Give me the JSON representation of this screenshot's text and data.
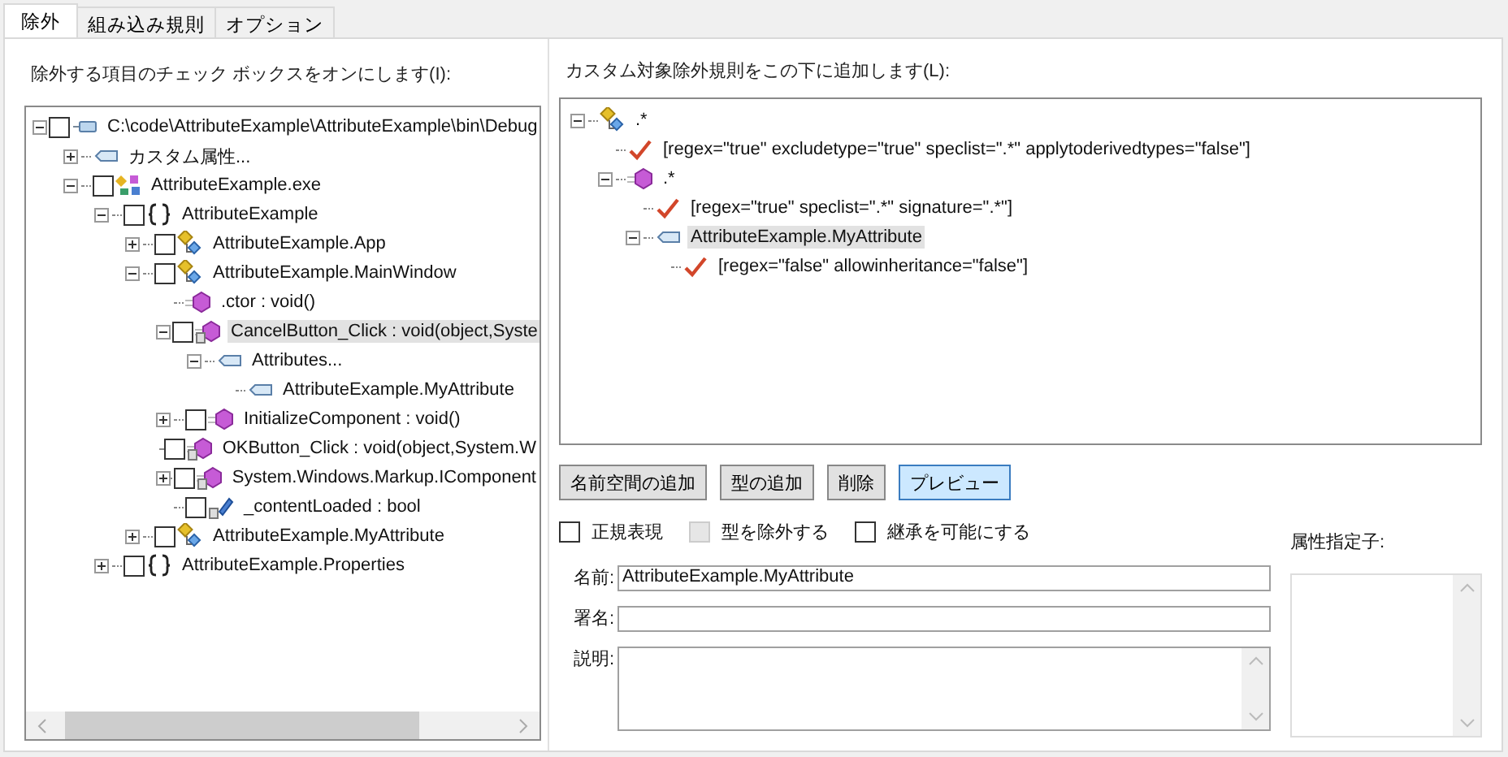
{
  "tabs": [
    {
      "label": "除外",
      "selected": true
    },
    {
      "label": "組み込み規則",
      "selected": false
    },
    {
      "label": "オプション",
      "selected": false
    }
  ],
  "exclude_panel": {
    "label": "除外する項目のチェック ボックスをオンにします(I):",
    "tree": [
      {
        "kind": "assembly",
        "label": "C:\\code\\AttributeExample\\AttributeExample\\bin\\Debug",
        "checked": false,
        "expanded": true,
        "selected": false,
        "children": [
          {
            "kind": "attribute",
            "label": "カスタム属性...",
            "expanded": false,
            "selected": false
          },
          {
            "kind": "exe",
            "label": "AttributeExample.exe",
            "checked": false,
            "expanded": true,
            "selected": false,
            "children": [
              {
                "kind": "namespace",
                "label": "AttributeExample",
                "checked": false,
                "expanded": true,
                "selected": false,
                "children": [
                  {
                    "kind": "class",
                    "label": "AttributeExample.App",
                    "checked": false,
                    "expanded": false,
                    "selected": false
                  },
                  {
                    "kind": "class",
                    "label": "AttributeExample.MainWindow",
                    "checked": false,
                    "expanded": true,
                    "selected": false,
                    "children": [
                      {
                        "kind": "method",
                        "label": ".ctor : void()",
                        "selected": false
                      },
                      {
                        "kind": "private_method",
                        "label": "CancelButton_Click : void(object,Syste",
                        "checked": false,
                        "expanded": true,
                        "selected": true,
                        "children": [
                          {
                            "kind": "attribute",
                            "label": "Attributes...",
                            "expanded": true,
                            "selected": false,
                            "children": [
                              {
                                "kind": "attribute",
                                "label": "AttributeExample.MyAttribute",
                                "selected": false
                              }
                            ]
                          }
                        ]
                      },
                      {
                        "kind": "method",
                        "label": "InitializeComponent : void()",
                        "checked": false,
                        "expanded": false,
                        "selected": false
                      },
                      {
                        "kind": "private_method",
                        "label": "OKButton_Click : void(object,System.W",
                        "checked": false,
                        "selected": false
                      },
                      {
                        "kind": "private_method",
                        "label": "System.Windows.Markup.IComponent",
                        "checked": false,
                        "expanded": false,
                        "selected": false
                      },
                      {
                        "kind": "private_field",
                        "label": "_contentLoaded : bool",
                        "checked": false,
                        "selected": false
                      }
                    ]
                  },
                  {
                    "kind": "class",
                    "label": "AttributeExample.MyAttribute",
                    "checked": false,
                    "expanded": false,
                    "selected": false
                  }
                ]
              },
              {
                "kind": "namespace",
                "label": "AttributeExample.Properties",
                "checked": false,
                "expanded": false,
                "selected": false
              }
            ]
          }
        ]
      }
    ]
  },
  "rules_panel": {
    "label": "カスタム対象除外規則をこの下に追加します(L):",
    "tree": [
      {
        "kind": "class",
        "label": ".*",
        "expanded": true,
        "selected": false,
        "children": [
          {
            "kind": "rule",
            "label": "[regex=\"true\" excludetype=\"true\" speclist=\".*\" applytoderivedtypes=\"false\"]",
            "selected": false
          },
          {
            "kind": "method",
            "label": ".*",
            "expanded": true,
            "selected": false,
            "children": [
              {
                "kind": "rule",
                "label": "[regex=\"true\" speclist=\".*\" signature=\".*\"]",
                "selected": false
              },
              {
                "kind": "attribute",
                "label": "AttributeExample.MyAttribute",
                "expanded": true,
                "selected": true,
                "children": [
                  {
                    "kind": "rule",
                    "label": "[regex=\"false\" allowinheritance=\"false\"]",
                    "selected": false
                  }
                ]
              }
            ]
          }
        ]
      }
    ]
  },
  "buttons": [
    {
      "label": "名前空間の追加",
      "selected": false
    },
    {
      "label": "型の追加",
      "selected": false
    },
    {
      "label": "削除",
      "selected": false
    },
    {
      "label": "プレビュー",
      "selected": true
    }
  ],
  "options": [
    {
      "label": "正規表現",
      "checked": false,
      "disabled": false
    },
    {
      "label": "型を除外する",
      "checked": false,
      "disabled": true
    },
    {
      "label": "継承を可能にする",
      "checked": false,
      "disabled": false
    }
  ],
  "fields": [
    {
      "kind": "line",
      "label": "名前:",
      "value": "AttributeExample.MyAttribute"
    },
    {
      "kind": "line",
      "label": "署名:"
    },
    {
      "kind": "multiline",
      "label": "説明:"
    }
  ],
  "attribute_specifiers": {
    "label": "属性指定子:"
  }
}
